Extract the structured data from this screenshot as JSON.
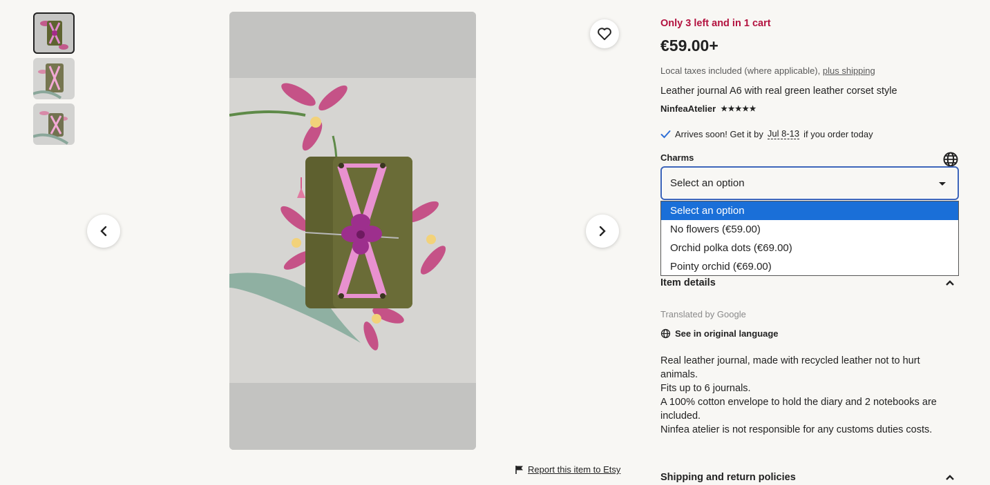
{
  "gallery": {
    "thumbnails": [
      {
        "label": "thumbnail-1",
        "active": true
      },
      {
        "label": "thumbnail-2",
        "active": false
      },
      {
        "label": "thumbnail-3",
        "active": false
      }
    ],
    "favorite_icon": "heart-icon",
    "prev_icon": "chevron-left-icon",
    "next_icon": "chevron-right-icon"
  },
  "report": {
    "text": "Report this item to Etsy",
    "icon": "flag-icon"
  },
  "listing": {
    "stock": "Only 3 left and in 1 cart",
    "price": "€59.00+",
    "tax_prefix": "Local taxes included (where applicable),",
    "tax_link": "plus shipping",
    "title": "Leather journal A6 with real green leather corset style",
    "shop_name": "NinfeaAtelier",
    "stars": "★★★★★",
    "rating": 5,
    "arrives_prefix": "Arrives soon! Get it by",
    "arrives_date": "Jul 8-13",
    "arrives_suffix": "if you order today"
  },
  "charms": {
    "label": "Charms",
    "selected": "Select an option",
    "options": [
      "Select an option",
      "No flowers (€59.00)",
      "Orchid polka dots (€69.00)",
      "Pointy orchid (€69.00)"
    ]
  },
  "details": {
    "header": "Item details",
    "translated": "Translated by Google",
    "original_language": "See in original language",
    "description": [
      "Real leather journal, made with recycled leather not to hurt animals.",
      "Fits up to 6 journals.",
      "A 100% cotton envelope to hold the diary and 2 notebooks are included.",
      "Ninfea atelier is not responsible for any customs duties costs."
    ]
  },
  "shipping": {
    "header": "Shipping and return policies"
  },
  "colors": {
    "stock": "#b3123f",
    "select_border": "#3b63b8",
    "option_highlight": "#1a6fd8",
    "check": "#2f6fd6"
  }
}
